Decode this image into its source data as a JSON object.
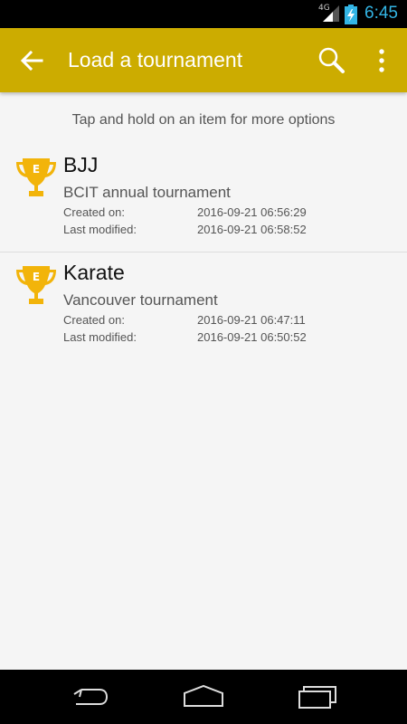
{
  "status_bar": {
    "network": "4G",
    "time": "6:45",
    "icons": [
      "signal-icon",
      "battery-charging-icon"
    ]
  },
  "app_bar": {
    "title": "Load a tournament",
    "color": "#ccac00",
    "icons": [
      "back-arrow-icon",
      "search-icon",
      "overflow-menu-icon"
    ]
  },
  "hint": "Tap and hold on an item for more options",
  "tournaments": [
    {
      "name": "BJJ",
      "description": "BCIT annual tournament",
      "created_label": "Created on:",
      "created_value": "2016-09-21 06:56:29",
      "modified_label": "Last modified:",
      "modified_value": "2016-09-21 06:58:52",
      "icon": "trophy-icon",
      "icon_letter": "E"
    },
    {
      "name": "Karate",
      "description": "Vancouver tournament",
      "created_label": "Created on:",
      "created_value": "2016-09-21 06:47:11",
      "modified_label": "Last modified:",
      "modified_value": "2016-09-21 06:50:52",
      "icon": "trophy-icon",
      "icon_letter": "E"
    }
  ],
  "nav_bar": {
    "icons": [
      "nav-back-icon",
      "nav-home-icon",
      "nav-recents-icon"
    ]
  }
}
